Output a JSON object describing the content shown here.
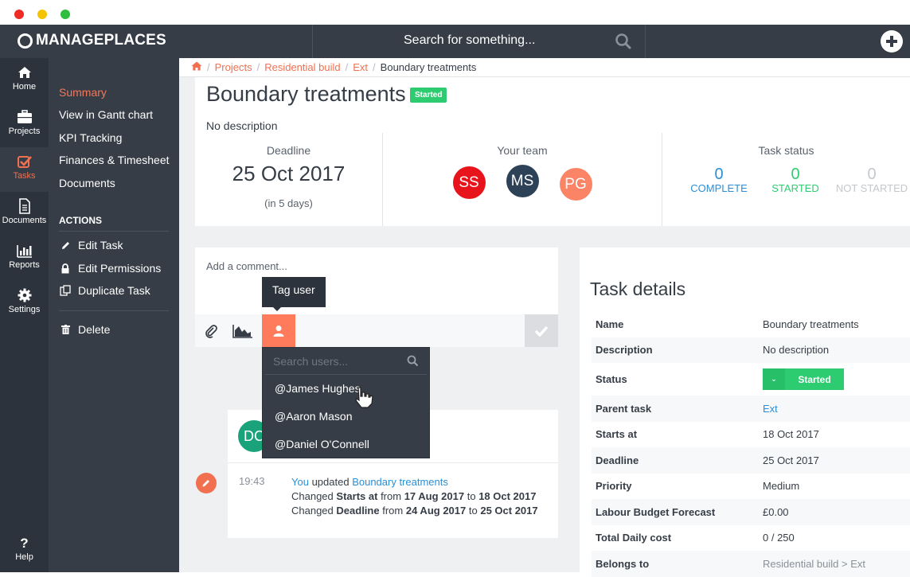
{
  "window": {
    "traffic_lights": [
      "#ee2b24",
      "#f5c400",
      "#2ebd3c"
    ]
  },
  "topbar": {
    "logo_text": "MANAGEPLACES",
    "search_placeholder": "Search for something...",
    "search_icon": "search-icon",
    "add_icon": "plus-circle-icon"
  },
  "iconbar": {
    "items": [
      {
        "label": "Home",
        "icon": "home-icon",
        "active": false
      },
      {
        "label": "Projects",
        "icon": "briefcase-icon",
        "active": false
      },
      {
        "label": "Tasks",
        "icon": "checkbox-icon",
        "active": true
      },
      {
        "label": "Documents",
        "icon": "document-icon",
        "active": false
      },
      {
        "label": "Reports",
        "icon": "bar-chart-icon",
        "active": false
      },
      {
        "label": "Settings",
        "icon": "gear-icon",
        "active": false
      }
    ],
    "help_label": "Help"
  },
  "subnav": {
    "links": [
      {
        "label": "Summary",
        "active": true
      },
      {
        "label": "View in Gantt chart"
      },
      {
        "label": "KPI Tracking"
      },
      {
        "label": "Finances & Timesheet"
      },
      {
        "label": "Documents"
      }
    ],
    "actions_heading": "ACTIONS",
    "actions": [
      {
        "label": "Edit Task",
        "icon": "pencil-icon"
      },
      {
        "label": "Edit Permissions",
        "icon": "lock-icon"
      },
      {
        "label": "Duplicate Task",
        "icon": "duplicate-icon"
      }
    ],
    "delete_label": "Delete"
  },
  "breadcrumb": {
    "home_icon": "home-icon",
    "items": [
      "Projects",
      "Residential build",
      "Ext"
    ],
    "current": "Boundary treatments"
  },
  "header": {
    "title": "Boundary treatments",
    "status_badge": "Started",
    "description": "No description",
    "deadline_label": "Deadline",
    "deadline_value": "25 Oct 2017",
    "deadline_relative": "(in 5 days)",
    "team_label": "Your team",
    "team": [
      {
        "initials": "SS",
        "color": "#e8141b"
      },
      {
        "initials": "MS",
        "color": "#2e4257"
      },
      {
        "initials": "PG",
        "color": "#fb8466"
      }
    ],
    "task_status_label": "Task status",
    "task_status": [
      {
        "count": "0",
        "label": "COMPLETE",
        "color": "#2a8fd6"
      },
      {
        "count": "0",
        "label": "STARTED",
        "color": "#2ecc71"
      },
      {
        "count": "0",
        "label": "NOT STARTED",
        "color": "#c4c7cc"
      }
    ]
  },
  "comment": {
    "placeholder": "Add a comment...",
    "tooltip": "Tag user",
    "tag_search_placeholder": "Search users...",
    "tag_users": [
      "@James Hughes",
      "@Aaron Mason",
      "@Daniel O'Connell"
    ]
  },
  "activity": {
    "avatar_initials": "DC",
    "time": "19:43",
    "actor": "You",
    "verb": "updated",
    "target": "Boundary treatments",
    "changes": [
      {
        "prefix": "Changed",
        "field": "Starts at",
        "from": "17 Aug 2017",
        "to": "18 Oct 2017"
      },
      {
        "prefix": "Changed",
        "field": "Deadline",
        "from": "24 Aug 2017",
        "to": "25 Oct 2017"
      }
    ],
    "from_word": "from",
    "to_word": "to"
  },
  "details": {
    "title": "Task details",
    "rows": [
      {
        "key": "Name",
        "value": "Boundary treatments"
      },
      {
        "key": "Description",
        "value": "No description"
      },
      {
        "key": "Status",
        "value": "Started"
      },
      {
        "key": "Parent task",
        "value": "Ext"
      },
      {
        "key": "Starts at",
        "value": "18 Oct 2017"
      },
      {
        "key": "Deadline",
        "value": "25 Oct 2017"
      },
      {
        "key": "Priority",
        "value": "Medium"
      },
      {
        "key": "Labour Budget Forecast",
        "value": "£0.00"
      },
      {
        "key": "Total Daily cost",
        "value": "0 / 250"
      },
      {
        "key": "Belongs to",
        "value": "Residential build > Ext"
      }
    ]
  }
}
